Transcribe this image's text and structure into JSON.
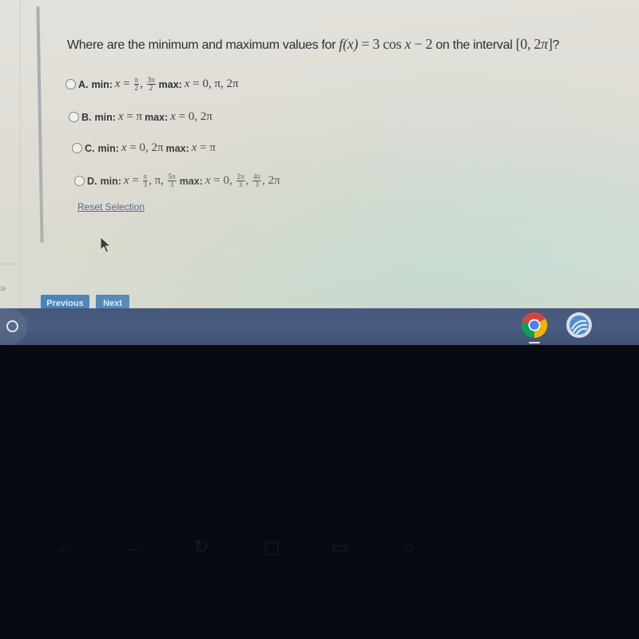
{
  "question": {
    "prefix": "Where are the minimum and maximum values for ",
    "function": "f(x) = 3 cos x − 2",
    "mid": " on the interval ",
    "interval": "[0, 2π]",
    "suffix": "?"
  },
  "options": [
    {
      "letter": "A.",
      "min_label": "min:",
      "min_values": "x = π/2, 3π/2",
      "max_label": "max:",
      "max_values": "x = 0, π, 2π",
      "selected": false
    },
    {
      "letter": "B.",
      "min_label": "min:",
      "min_values": "x = π",
      "max_label": "max:",
      "max_values": "x = 0, 2π",
      "selected": false
    },
    {
      "letter": "C.",
      "min_label": "min:",
      "min_values": "x = 0, 2π",
      "max_label": "max:",
      "max_values": "x = π",
      "selected": false
    },
    {
      "letter": "D.",
      "min_label": "min:",
      "min_values": "x = π/3, π, 5π/3",
      "max_label": "max:",
      "max_values": "x = 0, 2π/3, 4π/3, 2π",
      "selected": false
    }
  ],
  "math_parts": {
    "eq": " = ",
    "comma": ", ",
    "x": "x",
    "pi": "π",
    "two_pi": "2π",
    "zero": "0",
    "frac_pi_2": [
      "π",
      "2"
    ],
    "frac_3pi_2": [
      "3π",
      "2"
    ],
    "frac_pi_3": [
      "π",
      "3"
    ],
    "frac_5pi_3": [
      "5π",
      "3"
    ],
    "frac_2pi_3": [
      "2π",
      "3"
    ],
    "frac_4pi_3": [
      "4π",
      "3"
    ]
  },
  "reset_link": "Reset Selection",
  "nav": {
    "previous_label": "Previous",
    "next_label": "Next",
    "expand_icon": "»"
  },
  "shelf": {
    "launcher_icon": "launcher-circle",
    "apps": [
      {
        "name": "Google Chrome",
        "icon": "chrome-icon",
        "active": true
      },
      {
        "name": "App",
        "icon": "globe-app-icon",
        "active": false
      }
    ]
  },
  "colors": {
    "link": "#3d5b86",
    "button": "#2f78b9",
    "shelf": "#46587a",
    "text": "#2c2f33"
  }
}
